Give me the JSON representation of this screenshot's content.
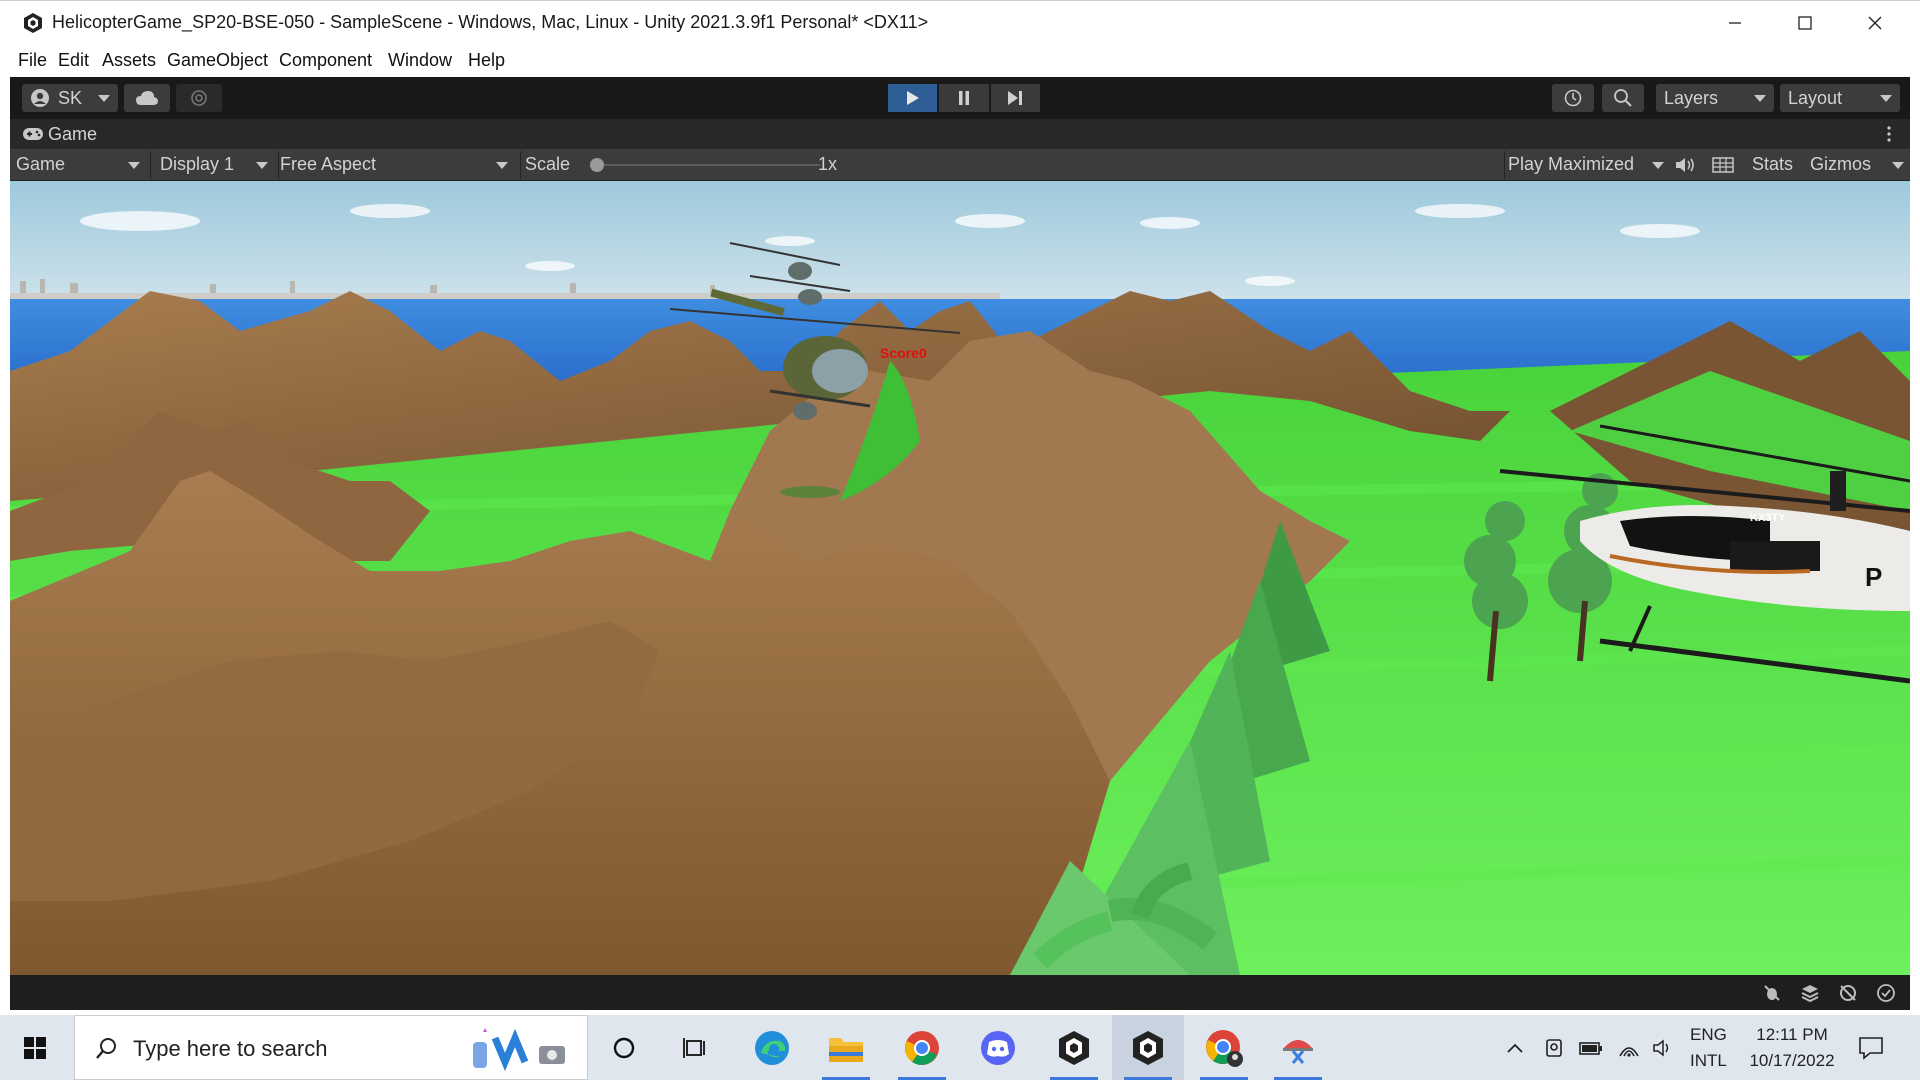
{
  "window": {
    "title": "HelicopterGame_SP20-BSE-050 - SampleScene - Windows, Mac, Linux - Unity 2021.3.9f1 Personal* <DX11>"
  },
  "menu": [
    "File",
    "Edit",
    "Assets",
    "GameObject",
    "Component",
    "Window",
    "Help"
  ],
  "toolbar": {
    "account_label": "SK",
    "layers_label": "Layers",
    "layout_label": "Layout"
  },
  "game_tab": {
    "label": "Game"
  },
  "game_bar": {
    "view_mode": "Game",
    "display": "Display 1",
    "aspect": "Free Aspect",
    "scale_label": "Scale",
    "scale_value": "1x",
    "scale_level": 0,
    "play_mode": "Play Maximized",
    "stats_label": "Stats",
    "gizmos_label": "Gizmos"
  },
  "scene": {
    "score_text": "Score0",
    "heli_tail_text": "KX3TY",
    "heli_body_text": "P"
  },
  "taskbar": {
    "search_placeholder": "Type here to search",
    "lang_top": "ENG",
    "lang_bottom": "INTL",
    "time": "12:11 PM",
    "date": "10/17/2022"
  },
  "colors": {
    "unity_toolbar": "#191919",
    "play_active": "#2f5e96",
    "score_red": "#e01010",
    "grass": "#55e046",
    "water": "#2b6fd0",
    "mountain": "#9a7046"
  }
}
